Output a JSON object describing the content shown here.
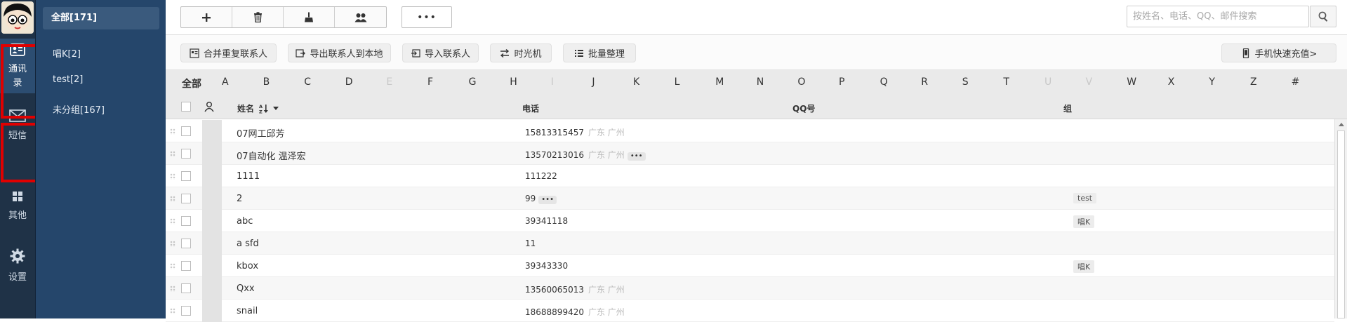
{
  "rail": {
    "items": [
      {
        "label": "通讯录",
        "icon": "contact-card-icon"
      },
      {
        "label": "短信",
        "icon": "envelope-icon"
      },
      {
        "label": "其他",
        "icon": "grid-icon"
      },
      {
        "label": "设置",
        "icon": "gear-icon"
      }
    ]
  },
  "groups": {
    "all": "全部[171]",
    "items": [
      "唱K[2]",
      "test[2]",
      "未分组[167]"
    ]
  },
  "toolbar": {
    "more": "•••",
    "search_placeholder": "按姓名、电话、QQ、邮件搜索"
  },
  "actions": {
    "merge": "合并重复联系人",
    "export": "导出联系人到本地",
    "import": "导入联系人",
    "timemachine": "时光机",
    "batch": "批量整理",
    "recharge": "手机快速充值>"
  },
  "alphabet": {
    "all": "全部",
    "letters": [
      "A",
      "B",
      "C",
      "D",
      "E",
      "F",
      "G",
      "H",
      "I",
      "J",
      "K",
      "L",
      "M",
      "N",
      "O",
      "P",
      "Q",
      "R",
      "S",
      "T",
      "U",
      "V",
      "W",
      "X",
      "Y",
      "Z",
      "#"
    ],
    "disabled": [
      "E",
      "I",
      "U",
      "V"
    ]
  },
  "table": {
    "headers": {
      "name": "姓名",
      "phone": "电话",
      "qq": "QQ号",
      "group": "组"
    },
    "rows": [
      {
        "name": "07网工邱芳",
        "phone": "15813315457",
        "loc": "广东 广州",
        "more": false,
        "group": ""
      },
      {
        "name": "07自动化 温泽宏",
        "phone": "13570213016",
        "loc": "广东 广州",
        "more": true,
        "group": ""
      },
      {
        "name": "1111",
        "phone": "111222",
        "loc": "",
        "more": false,
        "group": ""
      },
      {
        "name": "2",
        "phone": "99",
        "loc": "",
        "more": true,
        "group": "test"
      },
      {
        "name": "abc",
        "phone": "39341118",
        "loc": "",
        "more": false,
        "group": "唱K"
      },
      {
        "name": "a sfd",
        "phone": "11",
        "loc": "",
        "more": false,
        "group": ""
      },
      {
        "name": "kbox",
        "phone": "39343330",
        "loc": "",
        "more": false,
        "group": "唱K"
      },
      {
        "name": "Qxx",
        "phone": "13560065013",
        "loc": "广东 广州",
        "more": false,
        "group": ""
      },
      {
        "name": "snail",
        "phone": "18688899420",
        "loc": "广东 广州",
        "more": false,
        "group": ""
      }
    ]
  },
  "colors": {
    "rail": "#1f3247",
    "groups_bg": "#25466b",
    "highlight": "#e00000"
  }
}
